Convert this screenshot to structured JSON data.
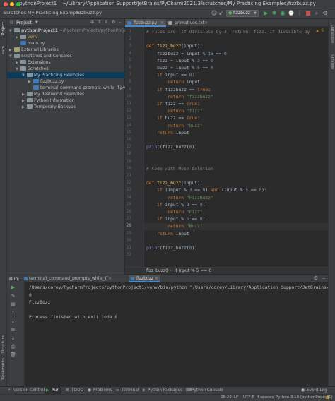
{
  "window": {
    "title": "pythonProject1 – ~/Library/Application Support/JetBrains/PyCharm2021.3/scratches/My Practicing Examples/fizzbuzz.py"
  },
  "nav": {
    "breadcrumbs": [
      "Scratches",
      "My Practicing Examples",
      "fizzbuzz.py"
    ],
    "run_config": "fizzbuzz"
  },
  "left_strip": [
    "Project",
    "Learn"
  ],
  "right_strip": [
    "Database",
    "SciView"
  ],
  "project": {
    "header": "Project",
    "items": [
      {
        "label": "pythonProject1",
        "extra": "~/PycharmProjects/pythonProject1",
        "indent": 0,
        "arrow": "▼",
        "icon": "folder"
      },
      {
        "label": "venv",
        "indent": 1,
        "arrow": "▶",
        "icon": "folder",
        "color": "#d9a343"
      },
      {
        "label": "main.py",
        "indent": 1,
        "arrow": "",
        "icon": "pyfile"
      },
      {
        "label": "External Libraries",
        "indent": 0,
        "arrow": "▶",
        "icon": "libs"
      },
      {
        "label": "Scratches and Consoles",
        "indent": 0,
        "arrow": "▼",
        "icon": "folder"
      },
      {
        "label": "Extensions",
        "indent": 1,
        "arrow": "▶",
        "icon": "folder"
      },
      {
        "label": "Scratches",
        "indent": 1,
        "arrow": "▼",
        "icon": "folder"
      },
      {
        "label": "My Practicing Examples",
        "indent": 2,
        "arrow": "▼",
        "icon": "folder",
        "selected": true
      },
      {
        "label": "fizzbuzz.py",
        "indent": 3,
        "arrow": "▶",
        "icon": "pyfile"
      },
      {
        "label": "terminal_command_prompts_while_if.py",
        "indent": 3,
        "arrow": "",
        "icon": "pyfile"
      },
      {
        "label": "My Realworld Examples",
        "indent": 2,
        "arrow": "▶",
        "icon": "folder"
      },
      {
        "label": "Python Information",
        "indent": 2,
        "arrow": "▶",
        "icon": "folder"
      },
      {
        "label": "Temporary Backups",
        "indent": 2,
        "arrow": "▶",
        "icon": "folder"
      }
    ]
  },
  "tabs": [
    {
      "label": "fizzbuzz.py",
      "active": true
    },
    {
      "label": "primatives.txt",
      "active": false
    }
  ],
  "editor": {
    "warning_count": "6",
    "caret_line": 28,
    "lines": [
      [
        [
          "cmt",
          "# rules are: If divisible by 3, return: fizz. If divisible by"
        ]
      ],
      [],
      [
        [
          "kw",
          "def "
        ],
        [
          "fn",
          "fizz_buzz"
        ],
        [
          "",
          "("
        ],
        [
          "",
          "input"
        ],
        [
          "",
          "):"
        ]
      ],
      [
        [
          "",
          "    fizzbuzz = "
        ],
        [
          "",
          "input"
        ],
        [
          "",
          " % "
        ],
        [
          "num",
          "15"
        ],
        [
          "",
          " == "
        ],
        [
          "num",
          "0"
        ]
      ],
      [
        [
          "",
          "    fizz = "
        ],
        [
          "",
          "input"
        ],
        [
          "",
          " % "
        ],
        [
          "num",
          "3"
        ],
        [
          "",
          " == "
        ],
        [
          "num",
          "0"
        ]
      ],
      [
        [
          "",
          "    buzz = "
        ],
        [
          "",
          "input"
        ],
        [
          "",
          " % "
        ],
        [
          "num",
          "5"
        ],
        [
          "",
          " == "
        ],
        [
          "num",
          "0"
        ]
      ],
      [
        [
          "kw",
          "    if "
        ],
        [
          "",
          "input"
        ],
        [
          "",
          " == "
        ],
        [
          "num",
          "0"
        ],
        [
          "",
          ":"
        ]
      ],
      [
        [
          "kw",
          "        return "
        ],
        [
          "",
          "input"
        ]
      ],
      [
        [
          "kw",
          "    if "
        ],
        [
          "",
          "fizzbuzz == "
        ],
        [
          "kw",
          "True"
        ],
        [
          "",
          ":"
        ]
      ],
      [
        [
          "kw",
          "        return "
        ],
        [
          "str",
          "\"fizzbuzz\""
        ]
      ],
      [
        [
          "kw",
          "    if "
        ],
        [
          "",
          "fizz == "
        ],
        [
          "kw",
          "True"
        ],
        [
          "",
          ":"
        ]
      ],
      [
        [
          "kw",
          "        return "
        ],
        [
          "str",
          "\"fizz\""
        ]
      ],
      [
        [
          "kw",
          "    if "
        ],
        [
          "",
          "buzz == "
        ],
        [
          "kw",
          "True"
        ],
        [
          "",
          ":"
        ]
      ],
      [
        [
          "kw",
          "        return "
        ],
        [
          "str",
          "\"buzz\""
        ]
      ],
      [
        [
          "kw",
          "    return "
        ],
        [
          "",
          "input"
        ]
      ],
      [],
      [
        [
          "bi",
          "print"
        ],
        [
          "",
          "(fizz_buzz("
        ],
        [
          "num",
          "0"
        ],
        [
          "",
          "))"
        ]
      ],
      [],
      [],
      [
        [
          "cmt",
          "# Code with Mosh Solution"
        ]
      ],
      [],
      [
        [
          "kw",
          "def "
        ],
        [
          "fn",
          "fizz_buzz"
        ],
        [
          "",
          "("
        ],
        [
          "",
          "input"
        ],
        [
          "",
          "):"
        ]
      ],
      [
        [
          "kw",
          "    if "
        ],
        [
          "",
          "("
        ],
        [
          "",
          "input"
        ],
        [
          "",
          " % "
        ],
        [
          "num",
          "3"
        ],
        [
          "",
          " == "
        ],
        [
          "num",
          "0"
        ],
        [
          "",
          ") "
        ],
        [
          "kw",
          "and "
        ],
        [
          "",
          "("
        ],
        [
          "",
          "input"
        ],
        [
          "",
          " % "
        ],
        [
          "num",
          "5"
        ],
        [
          "",
          " == "
        ],
        [
          "num",
          "0"
        ],
        [
          "",
          "):"
        ]
      ],
      [
        [
          "kw",
          "        return "
        ],
        [
          "str",
          "\"FizzBuzz\""
        ]
      ],
      [
        [
          "kw",
          "    if "
        ],
        [
          "",
          "input"
        ],
        [
          "",
          " % "
        ],
        [
          "num",
          "3"
        ],
        [
          "",
          " == "
        ],
        [
          "num",
          "0"
        ],
        [
          "",
          ":"
        ]
      ],
      [
        [
          "kw",
          "        return "
        ],
        [
          "str",
          "\"Fizz\""
        ]
      ],
      [
        [
          "kw",
          "    if "
        ],
        [
          "",
          "input"
        ],
        [
          "",
          " % "
        ],
        [
          "num",
          "5"
        ],
        [
          "",
          " == "
        ],
        [
          "num",
          "0"
        ],
        [
          "",
          ":"
        ]
      ],
      [
        [
          "kw",
          "        return "
        ],
        [
          "str",
          "\"Buzz\""
        ]
      ],
      [
        [
          "kw",
          "    return "
        ],
        [
          "",
          "input"
        ]
      ],
      [],
      [
        [
          "bi",
          "print"
        ],
        [
          "",
          "(fizz_buzz("
        ],
        [
          "num",
          "0"
        ],
        [
          "",
          "))"
        ]
      ],
      []
    ]
  },
  "editor_crumb": [
    "fizz_buzz()",
    "if input % 5 == 0"
  ],
  "run": {
    "label": "Run:",
    "tabs": [
      {
        "label": "terminal_command_prompts_while_if",
        "active": false
      },
      {
        "label": "fizzbuzz",
        "active": true
      }
    ],
    "output": [
      "/Users/corey/PycharmProjects/pythonProject1/venv/bin/python \"/Users/corey/Library/Application Support/JetBrains/PyChar",
      "0",
      "FizzBuzz",
      "",
      "Process finished with exit code 0"
    ],
    "side_labels": [
      "Structure",
      "Bookmarks"
    ]
  },
  "bottom_tools": [
    {
      "label": "Version Control",
      "active": false
    },
    {
      "label": "Run",
      "active": true
    },
    {
      "label": "TODO",
      "active": false
    },
    {
      "label": "Problems",
      "active": false
    },
    {
      "label": "Terminal",
      "active": false
    },
    {
      "label": "Python Packages",
      "active": false
    },
    {
      "label": "Python Console",
      "active": false
    }
  ],
  "event_log": "Event Log",
  "status": {
    "position": "28:22",
    "line_sep": "LF",
    "encoding": "UTF-8",
    "indent": "4 spaces",
    "interpreter": "Python 3.10 (pythonProject1)"
  }
}
